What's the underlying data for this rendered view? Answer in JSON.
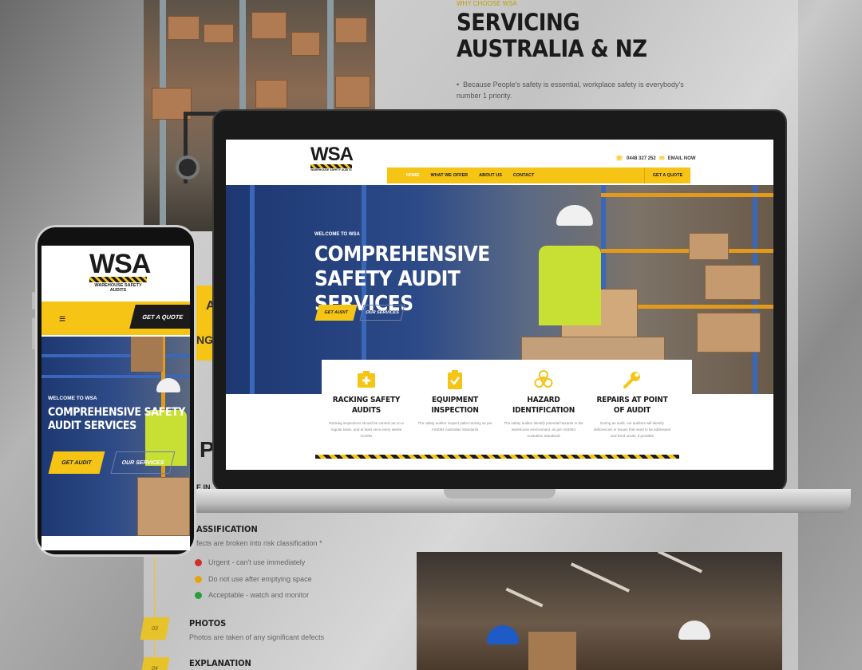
{
  "background": {
    "eyebrow": "WHY CHOOSE WSA",
    "heading": "SERVICING AUSTRALIA & NZ",
    "bullet": "Because People's safety is essential, workplace safety is everybody's number 1 priority.",
    "fragments": {
      "a": "A",
      "ng": "NG",
      "p": "P",
      "in": "E IN"
    },
    "classification": {
      "title": "ASSIFICATION",
      "subtitle": "fects are broken into risk classification *",
      "legend": [
        {
          "label": "Urgent - can't use immediately",
          "color": "#d22f27"
        },
        {
          "label": "Do not use after emptying space",
          "color": "#e8a20c"
        },
        {
          "label": "Acceptable - watch and monitor",
          "color": "#2a9d3c"
        }
      ]
    },
    "steps": [
      {
        "num": "03",
        "title": "PHOTOS",
        "subtitle": "Photos are taken of any significant defects"
      },
      {
        "num": "04",
        "title": "EXPLANATION",
        "subtitle": ""
      }
    ]
  },
  "colors": {
    "brand_yellow": "#f6c414",
    "brand_dark": "#1b1b1b",
    "hero_blue": "#1d3872"
  },
  "desktop": {
    "logo": {
      "text": "WSA",
      "tagline": "WAREHOUSE SAFETY AUDITS"
    },
    "contact": {
      "phone": "0448 327 252",
      "phone_icon": "phone-icon",
      "email": "EMAIL NOW",
      "email_icon": "envelope-icon"
    },
    "nav": [
      "HOME",
      "WHAT WE OFFER",
      "ABOUT US",
      "CONTACT"
    ],
    "quote": "GET A QUOTE",
    "hero": {
      "welcome": "WELCOME TO WSA",
      "title": "COMPREHENSIVE SAFETY AUDIT SERVICES",
      "btn_primary": "GET AUDIT",
      "btn_secondary": "OUR SERVICES"
    },
    "services": [
      {
        "icon": "first-aid-icon",
        "title": "RACKING SAFETY AUDITS",
        "desc": "Racking inspections should be carried out on a regular basis, and at least once every twelve months"
      },
      {
        "icon": "clipboard-check-icon",
        "title": "EQUIPMENT INSPECTION",
        "desc": "The safety auditor inspect pallet racking as per AS4084 Australian Standards"
      },
      {
        "icon": "biohazard-icon",
        "title": "HAZARD IDENTIFICATION",
        "desc": "The safety auditor identify potential hazards in the warehouse environment, as per AS4084 Australian Standards"
      },
      {
        "icon": "wrench-icon",
        "title": "REPAIRS AT POINT OF AUDIT",
        "desc": "During an audit, our auditors will identify deficiencies or issues that need to be addressed and fixed onsite, if possible"
      }
    ]
  },
  "mobile": {
    "logo": {
      "text": "WSA",
      "tagline": "WAREHOUSE SAFETY AUDITS"
    },
    "menu_icon": "hamburger-icon",
    "quote": "GET A QUOTE",
    "hero": {
      "welcome": "WELCOME TO WSA",
      "title": "COMPREHENSIVE SAFETY AUDIT SERVICES",
      "btn_primary": "GET AUDIT",
      "btn_secondary": "OUR SERVICES"
    }
  }
}
